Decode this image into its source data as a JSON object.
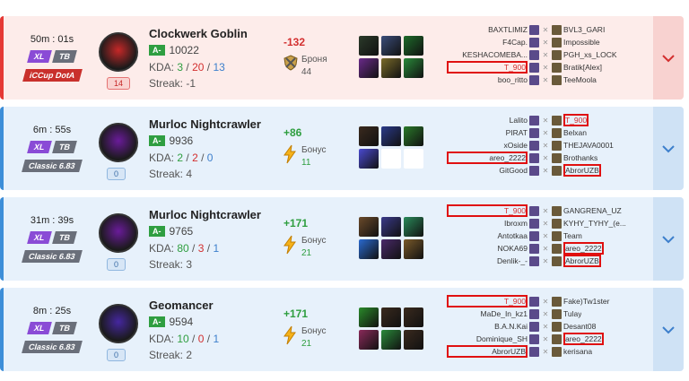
{
  "matches": [
    {
      "result": "loss",
      "duration": "50m : 01s",
      "tags": [
        "XL",
        "TB"
      ],
      "mode": "iCCup DotA",
      "level": "14",
      "hero": "Clockwerk Goblin",
      "rank": "A-",
      "mmr": "10022",
      "kda_label": "KDA:",
      "kills": "3",
      "deaths": "20",
      "assists": "13",
      "streak": "Streak: -1",
      "delta": "-132",
      "bonus_label": "Броня",
      "bonus_value": "44",
      "left_team": [
        "BAXTLIMIZ",
        "F4Cap.",
        "KESHACOMEBA...",
        "T_900",
        "boo_ritto"
      ],
      "right_team": [
        "BVL3_GARI",
        "Impossible",
        "PGH_xs_LOCK",
        "Bratik[Alex]",
        "TeeMoola"
      ]
    },
    {
      "result": "win",
      "duration": "6m : 55s",
      "tags": [
        "XL",
        "TB"
      ],
      "mode": "Classic 6.83",
      "level": "0",
      "hero": "Murloc Nightcrawler",
      "rank": "A-",
      "mmr": "9936",
      "kda_label": "KDA:",
      "kills": "2",
      "deaths": "2",
      "assists": "0",
      "streak": "Streak: 4",
      "delta": "+86",
      "bonus_label": "Бонус",
      "bonus_value": "11",
      "left_team": [
        "Lalito",
        "PIRAT",
        "xOside",
        "areo_2222",
        "GitGood"
      ],
      "right_team": [
        "T_900",
        "Belxan",
        "THEJAVA0001",
        "Brothanks",
        "AbrorUZB"
      ]
    },
    {
      "result": "win",
      "duration": "31m : 39s",
      "tags": [
        "XL",
        "TB"
      ],
      "mode": "Classic 6.83",
      "level": "0",
      "hero": "Murloc Nightcrawler",
      "rank": "A-",
      "mmr": "9765",
      "kda_label": "KDA:",
      "kills": "80",
      "deaths": "3",
      "assists": "1",
      "streak": "Streak: 3",
      "delta": "+171",
      "bonus_label": "Бонус",
      "bonus_value": "21",
      "left_team": [
        "T_900",
        "Ibroxm",
        "Antotkaa",
        "NOKA69",
        "Denlik-_-"
      ],
      "right_team": [
        "GANGRENA_UZ",
        "KYHY_TYHY_(e...",
        "Team",
        "areo_2222",
        "AbrorUZB"
      ]
    },
    {
      "result": "win",
      "duration": "8m : 25s",
      "tags": [
        "XL",
        "TB"
      ],
      "mode": "Classic 6.83",
      "level": "0",
      "hero": "Geomancer",
      "rank": "A-",
      "mmr": "9594",
      "kda_label": "KDA:",
      "kills": "10",
      "deaths": "0",
      "assists": "1",
      "streak": "Streak: 2",
      "delta": "+171",
      "bonus_label": "Бонус",
      "bonus_value": "21",
      "left_team": [
        "T_900",
        "MaDe_In_kz1",
        "B.A.N.Kai",
        "Dominique_SH",
        "AbrorUZB"
      ],
      "right_team": [
        "Fake)Tw1ster",
        "Tulay",
        "Desant08",
        "areo_2222",
        "kerisana"
      ]
    }
  ],
  "icons": {
    "expand": "chevron-down-icon",
    "bonus_win": "lightning-icon",
    "bonus_loss": "crossed-swords-shield-icon",
    "vs": "swords-icon"
  },
  "colors": {
    "loss": "#e53935",
    "win": "#3d8ed8",
    "kills": "#2e9e3f",
    "deaths": "#d32f2f",
    "assists": "#3d7fcc"
  }
}
